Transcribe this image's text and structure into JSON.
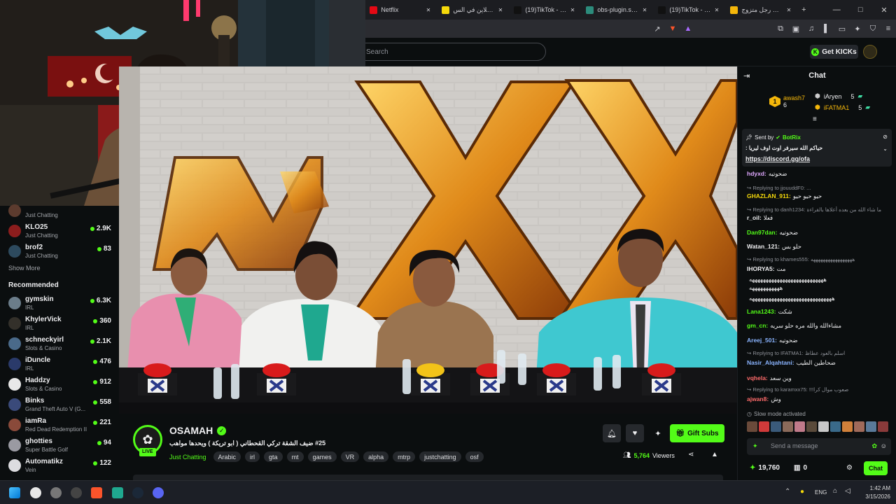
{
  "browser": {
    "tabs": [
      {
        "label": "Netflix",
        "color": "#e50914"
      },
      {
        "label": "نؤتها أونلاين في الس...",
        "color": "#f5d90a"
      },
      {
        "label": "(19)TikTok - Make Y...",
        "color": "#111111"
      },
      {
        "label": "obs-plugin.streami...",
        "color": "#2c8c7c"
      },
      {
        "label": "(19)TikTok - Make Y...",
        "color": "#111111"
      },
      {
        "label": "يوميات رجل متزوج...",
        "color": "#f5b70a"
      }
    ],
    "new_tab": "+",
    "window_controls": {
      "minimize": "—",
      "maximize": "□",
      "close": "✕"
    }
  },
  "header": {
    "search_placeholder": "Search",
    "get_kicks_label": "Get KICKs",
    "kick_badge": "K"
  },
  "sidebar": {
    "channels": [
      {
        "name": "",
        "category": "Just Chatting",
        "viewers": "",
        "avatar": "#5c3b2e"
      },
      {
        "name": "KLO25",
        "category": "Just Chatting",
        "viewers": "2.9K",
        "avatar": "#8c1d1d"
      },
      {
        "name": "brof2",
        "category": "Just Chatting",
        "viewers": "83",
        "avatar": "#2d4a5e"
      }
    ],
    "show_more": "Show More",
    "recommended_title": "Recommended",
    "recommended": [
      {
        "name": "gymskin",
        "category": "IRL",
        "viewers": "6.3K",
        "avatar": "#6b7d8a"
      },
      {
        "name": "KhylerVick",
        "category": "IRL",
        "viewers": "360",
        "avatar": "#33302a"
      },
      {
        "name": "schneckyirl",
        "category": "Slots & Casino",
        "viewers": "2.1K",
        "avatar": "#4a6a8a"
      },
      {
        "name": "iDuncle",
        "category": "IRL",
        "viewers": "476",
        "avatar": "#2a3a6a"
      },
      {
        "name": "Haddzy",
        "category": "Slots & Casino",
        "viewers": "912",
        "avatar": "#e8e8e8"
      },
      {
        "name": "Binks",
        "category": "Grand Theft Auto V (G...",
        "viewers": "558",
        "avatar": "#3a4a7a"
      },
      {
        "name": "iamRa",
        "category": "Red Dead Redemption II",
        "viewers": "221",
        "avatar": "#8a4a3a"
      },
      {
        "name": "ghotties",
        "category": "Super Battle Golf",
        "viewers": "94",
        "avatar": "#9a9aa2"
      },
      {
        "name": "Automatikz",
        "category": "Vein",
        "viewers": "122",
        "avatar": "#dcdce0"
      }
    ]
  },
  "stream": {
    "channel_name": "OSAMAH",
    "live_badge": "LIVE",
    "title": "#25 ضيف الشقة تركي القحطاني ( ابو تريكة ) ويحدها مواهب",
    "category": "Just Chatting",
    "tags": [
      "Arabic",
      "irl",
      "gta",
      "mt",
      "games",
      "VR",
      "alpha",
      "mtrp",
      "justchatting",
      "osf"
    ],
    "viewers": "5,764",
    "viewers_label": "Viewers",
    "gift_subs_label": "Gift Subs"
  },
  "chat": {
    "title": "Chat",
    "leaderboard": [
      {
        "rank": "1",
        "name": "awash7",
        "score": "6"
      },
      {
        "rank": "",
        "name": "iAryen",
        "score": "5"
      },
      {
        "rank": "",
        "name": "iFATMA1",
        "score": "5"
      }
    ],
    "pinned": {
      "sent_by_label": "Sent by",
      "sender": "BotRix",
      "text": "حياكم الله سيرفر اوت اوف ليريا :",
      "link": "https://discord.gg/ofa"
    },
    "messages": [
      {
        "type": "msg",
        "user": "hdyxd:",
        "text": "ضحوتيه",
        "color": "#e0a8ff"
      },
      {
        "type": "reply",
        "text": "Replying to jjouuddF0: ..."
      },
      {
        "type": "msg",
        "user": "GHAZLAN_911:",
        "text": "حيو حيو حيو",
        "color": "#f5d90a"
      },
      {
        "type": "reply",
        "text": "Replying to danh1234: ما شاء الله من بعده أعلاها بالقراءة"
      },
      {
        "type": "msg",
        "user": "r_oil:",
        "text": "فعلا",
        "color": "#efeff1"
      },
      {
        "type": "msg",
        "user": "Dan97dan:",
        "text": "ضحوتيه",
        "color": "#53fc18"
      },
      {
        "type": "msg",
        "user": "Watan_121:",
        "text": "حلو بس",
        "color": "#efeff1"
      },
      {
        "type": "reply",
        "text": "Replying to khames555: هههههههههههههههههه"
      },
      {
        "type": "msg",
        "user": "IHORYA5:",
        "text": "مت",
        "color": "#efeff1"
      },
      {
        "type": "msg",
        "user": "",
        "text": "هههههههههههههههههههههههههههه",
        "color": "#efeff1"
      },
      {
        "type": "msg",
        "user": "",
        "text": "هههههههههههه",
        "color": "#efeff1"
      },
      {
        "type": "msg",
        "user": "",
        "text": "ههههههههههههههههههههههههههههههه",
        "color": "#efeff1"
      },
      {
        "type": "msg",
        "user": "Lana1243:",
        "text": "شكت",
        "color": "#53fc18"
      },
      {
        "type": "msg",
        "user": "gm_cn:",
        "text": "مشاءالله والله مره حلو سريه",
        "color": "#53fc18"
      },
      {
        "type": "msg",
        "user": "Areej_501:",
        "text": "ضحوتيه",
        "color": "#8ab4ff"
      },
      {
        "type": "reply",
        "text": "Replying to IFATMA1: اسلم بالعود عطاظ"
      },
      {
        "type": "msg",
        "user": "Nasir_Alqahtani:",
        "text": "ضحاطين الطيب",
        "color": "#8ab4ff"
      },
      {
        "type": "msg",
        "user": "vqhela:",
        "text": "وين سعد",
        "color": "#ff6b6b"
      },
      {
        "type": "reply",
        "text": "Replying to karamxx75: !!!صعوب موال كرا"
      },
      {
        "type": "msg",
        "user": "ajwan8:",
        "text": "وش",
        "color": "#ff6b6b"
      }
    ],
    "slow_mode": "Slow mode activated",
    "input_placeholder": "Send a message",
    "points": "19,760",
    "gifts": "0",
    "send_label": "Chat"
  },
  "taskbar": {
    "language": "ENG",
    "time": "1:42 AM",
    "date": "3/15/2026"
  }
}
